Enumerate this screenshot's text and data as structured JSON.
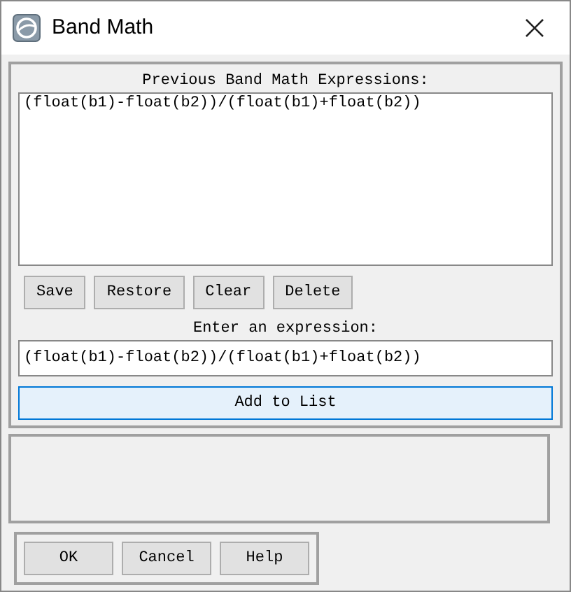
{
  "window": {
    "title": "Band Math"
  },
  "previous": {
    "label": "Previous Band Math Expressions:",
    "items": [
      {
        "text": "(float(b1)-float(b2))/(float(b1)+float(b2))",
        "selected": false
      }
    ]
  },
  "list_buttons": [
    "Save",
    "Restore",
    "Clear",
    "Delete"
  ],
  "expression": {
    "label": "Enter an expression:",
    "value": "(float(b1)-float(b2))/(float(b1)+float(b2))"
  },
  "add_button": "Add to List",
  "dialog_buttons": [
    "OK",
    "Cancel",
    "Help"
  ]
}
